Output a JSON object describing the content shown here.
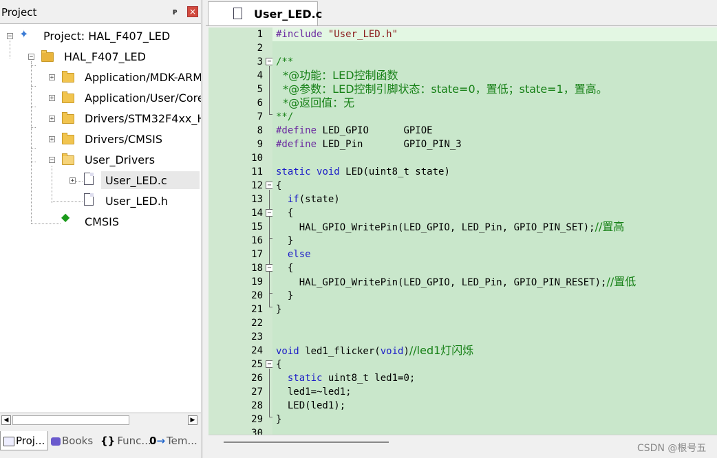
{
  "project_panel": {
    "title": "Project",
    "pin_glyph": "Ԅ",
    "close_glyph": "×",
    "tree": [
      {
        "label": "Project: HAL_F407_LED",
        "icon": "project-icon"
      },
      {
        "label": "HAL_F407_LED",
        "icon": "target-icon"
      },
      {
        "label": "Application/MDK-ARM",
        "icon": "folder-icon"
      },
      {
        "label": "Application/User/Core",
        "icon": "folder-icon"
      },
      {
        "label": "Drivers/STM32F4xx_HAL",
        "icon": "folder-icon"
      },
      {
        "label": "Drivers/CMSIS",
        "icon": "folder-icon"
      },
      {
        "label": "User_Drivers",
        "icon": "folder-open-icon"
      },
      {
        "label": "User_LED.c",
        "icon": "c-file-icon"
      },
      {
        "label": "User_LED.h",
        "icon": "h-file-icon"
      },
      {
        "label": "CMSIS",
        "icon": "cmsis-icon"
      }
    ],
    "bottom_tabs": [
      "Proj...",
      "Books",
      "Func...",
      "Tem..."
    ]
  },
  "editor": {
    "tab_label": "User_LED.c",
    "line_numbers": [
      "1",
      "2",
      "3",
      "4",
      "5",
      "6",
      "7",
      "8",
      "9",
      "10",
      "11",
      "12",
      "13",
      "14",
      "15",
      "16",
      "17",
      "18",
      "19",
      "20",
      "21",
      "22",
      "23",
      "24",
      "25",
      "26",
      "27",
      "28",
      "29",
      "30"
    ],
    "lines": {
      "l1_pp": "#include",
      "l1_str": " \"User_LED.h\"",
      "l3": "/**",
      "l4": "  *@功能：LED控制函数",
      "l5": "  *@参数：LED控制引脚状态：state=0，置低；state=1，置高。",
      "l6": "  *@返回值：无",
      "l7": "**/",
      "l8_pp": "#define",
      "l8_rest": " LED_GPIO      GPIOE",
      "l9_pp": "#define",
      "l9_rest": " LED_Pin       GPIO_PIN_3",
      "l11_kw1": "static",
      "l11_kw2": "void",
      "l11_rest": " LED(uint8_t state)",
      "l12": "{",
      "l13_kw": "if",
      "l13_rest": "(state)",
      "l14": "  {",
      "l15_code": "    HAL_GPIO_WritePin(LED_GPIO, LED_Pin, GPIO_PIN_SET);",
      "l15_cm": "//置高",
      "l16": "  }",
      "l17_kw": "else",
      "l18": "  {",
      "l19_code": "    HAL_GPIO_WritePin(LED_GPIO, LED_Pin, GPIO_PIN_RESET);",
      "l19_cm": "//置低",
      "l20": "  }",
      "l21": "}",
      "l24_kw": "void",
      "l24_fn": " led1_flicker(",
      "l24_kw2": "void",
      "l24_close": ")",
      "l24_cm": "//led1灯闪烁",
      "l25": "{",
      "l26_kw": "static",
      "l26_rest": " uint8_t led1=0;",
      "l27": "  led1=~led1;",
      "l28": "  LED(led1);",
      "l29": "}"
    }
  },
  "watermark": "CSDN @根号五"
}
